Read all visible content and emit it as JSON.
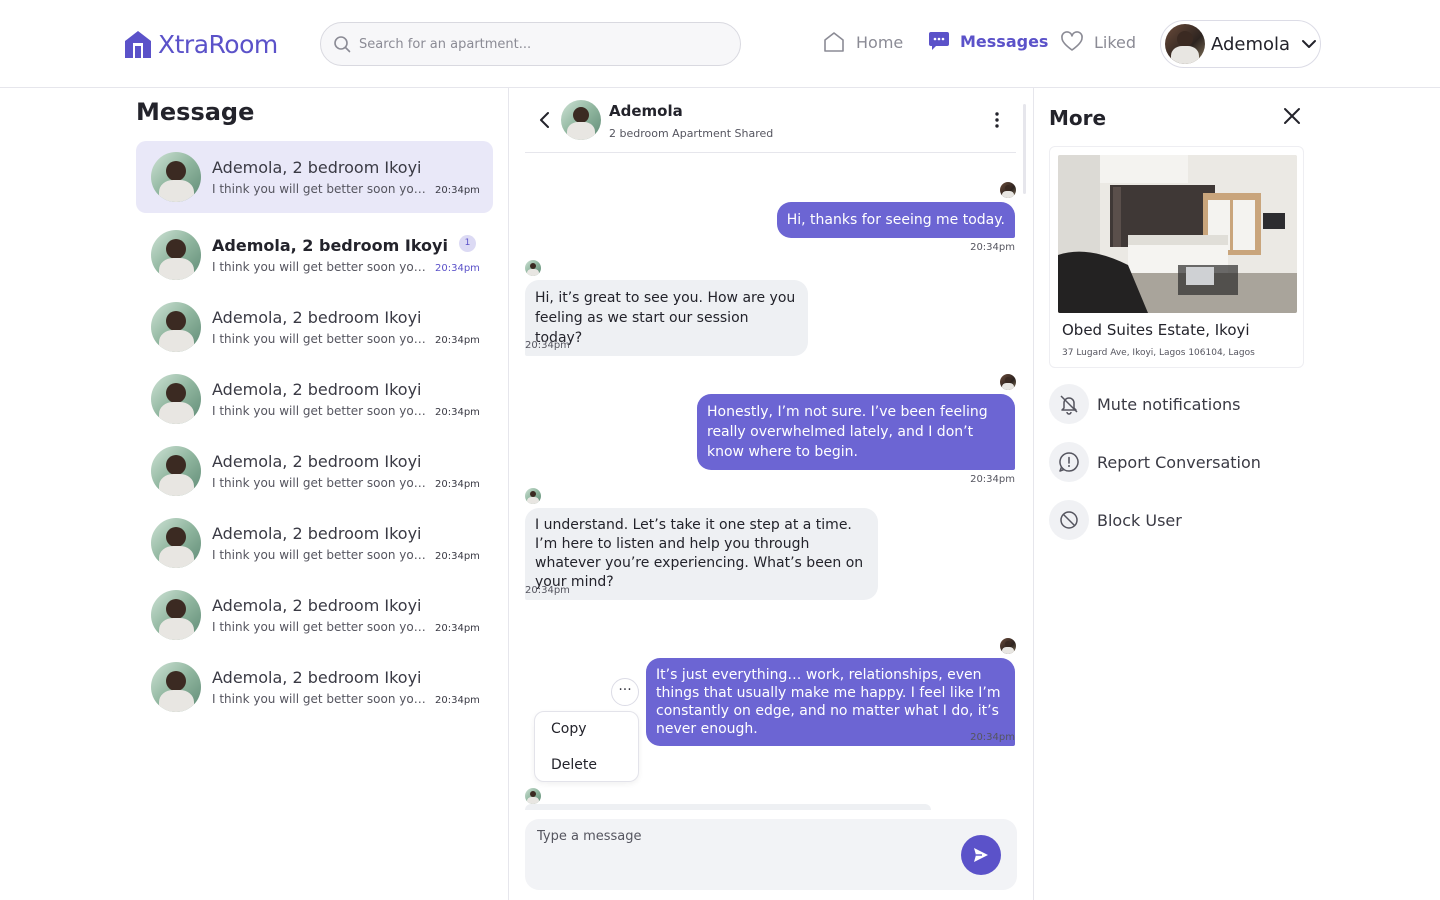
{
  "brand": {
    "name": "XtraRoom",
    "color": "#5b52c9"
  },
  "search": {
    "placeholder": "Search for an apartment..."
  },
  "nav": {
    "home": "Home",
    "messages": "Messages",
    "liked": "Liked"
  },
  "user": {
    "name": "Ademola"
  },
  "messages_panel": {
    "title": "Message",
    "conversations": [
      {
        "title": "Ademola, 2 bedroom Ikoyi",
        "preview": "I think you will get better soon you just need to rest",
        "time": "20:34pm",
        "active": true,
        "unread": null
      },
      {
        "title": "Ademola, 2 bedroom Ikoyi",
        "preview": "I think you will get better soon you just need to rest",
        "time": "20:34pm",
        "active": false,
        "unread": "1"
      },
      {
        "title": "Ademola, 2 bedroom Ikoyi",
        "preview": "I think you will get better soon you just need to rest",
        "time": "20:34pm",
        "active": false,
        "unread": null
      },
      {
        "title": "Ademola, 2 bedroom Ikoyi",
        "preview": "I think you will get better soon you just need to rest",
        "time": "20:34pm",
        "active": false,
        "unread": null
      },
      {
        "title": "Ademola, 2 bedroom Ikoyi",
        "preview": "I think you will get better soon you just need to rest",
        "time": "20:34pm",
        "active": false,
        "unread": null
      },
      {
        "title": "Ademola, 2 bedroom Ikoyi",
        "preview": "I think you will get better soon you just need to rest",
        "time": "20:34pm",
        "active": false,
        "unread": null
      },
      {
        "title": "Ademola, 2 bedroom Ikoyi",
        "preview": "I think you will get better soon you just need to rest",
        "time": "20:34pm",
        "active": false,
        "unread": null
      },
      {
        "title": "Ademola, 2 bedroom Ikoyi",
        "preview": "I think you will get better soon you just need to rest",
        "time": "20:34pm",
        "active": false,
        "unread": null
      }
    ]
  },
  "chat": {
    "contact_name": "Ademola",
    "contact_sub": "2 bedroom Apartment Shared",
    "messages": [
      {
        "dir": "out",
        "text": "Hi, thanks for seeing me today.",
        "time": "20:34pm"
      },
      {
        "dir": "in",
        "text": "Hi, it’s great to see you. How are you feeling as we start our session today?",
        "time": "20:34pm"
      },
      {
        "dir": "out",
        "text": "Honestly, I’m not sure. I’ve been feeling really overwhelmed lately, and I don’t know where to begin.",
        "time": "20:34pm"
      },
      {
        "dir": "in",
        "text": "I understand. Let’s take it one step at a time. I’m here to listen and help you through whatever you’re experiencing. What’s been on your mind?",
        "time": "20:34pm"
      },
      {
        "dir": "out",
        "text": "It’s just everything… work, relationships, even things that usually make me happy. I feel like I’m constantly on edge, and no matter what I do, it’s never enough.",
        "time": "20:34pm"
      }
    ],
    "more_dots": "···",
    "context_menu": {
      "copy": "Copy",
      "delete": "Delete"
    },
    "composer_placeholder": "Type a message"
  },
  "more_panel": {
    "title": "More",
    "property": {
      "name": "Obed Suites Estate, Ikoyi",
      "address": "37 Lugard Ave, Ikoyi, Lagos 106104, Lagos"
    },
    "actions": {
      "mute": "Mute notifications",
      "report": "Report Conversation",
      "block": "Block User"
    }
  },
  "icons": {
    "logo": "house-logo-icon",
    "search": "search-icon",
    "home": "home-icon",
    "messages": "chat-bubble-icon",
    "liked": "heart-icon",
    "dropdown": "chevron-down-icon",
    "back": "chevron-left-icon",
    "menu": "kebab-icon",
    "send": "send-icon",
    "close": "close-icon",
    "mute": "bell-off-icon",
    "report": "alert-circle-icon",
    "block": "block-icon"
  },
  "colors": {
    "accent": "#5b52c9",
    "outgoing_bubble": "#6c65d3",
    "incoming_bubble": "#eef0f3",
    "active_row": "#e9e8f8"
  }
}
